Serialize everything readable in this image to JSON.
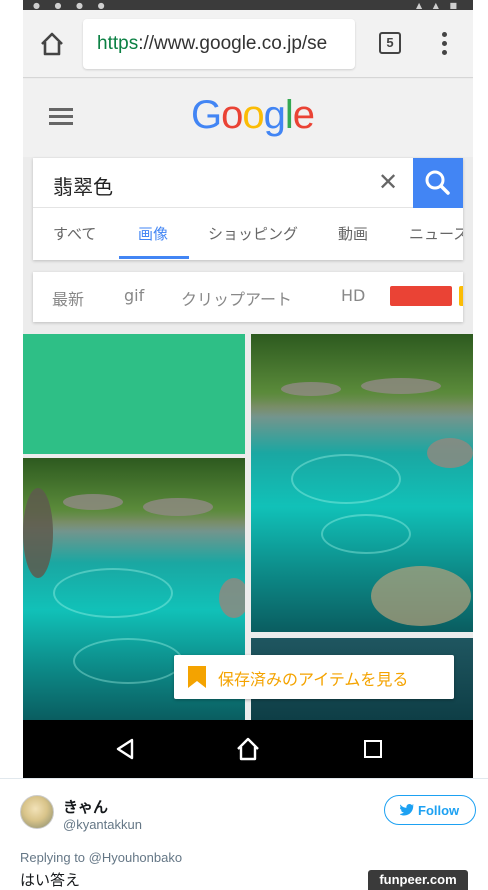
{
  "browser": {
    "url_scheme": "https",
    "url_rest": "://www.google.co.jp/se",
    "tab_count": "5"
  },
  "google": {
    "logo_letters": [
      "G",
      "o",
      "o",
      "g",
      "l",
      "e"
    ],
    "search_query": "翡翠色",
    "tabs": [
      {
        "label": "すべて",
        "active": false
      },
      {
        "label": "画像",
        "active": true
      },
      {
        "label": "ショッピング",
        "active": false
      },
      {
        "label": "動画",
        "active": false
      },
      {
        "label": "ニュース",
        "active": false
      }
    ],
    "chips": [
      "最新",
      "gif",
      "クリップアート",
      "HD"
    ],
    "chip_colors": [
      "#ea4335",
      "#fbbc05"
    ],
    "saved_items_label": "保存済みのアイテムを見る",
    "tile_color": "#2ebf86"
  },
  "navbar": {
    "icons": [
      "back-icon",
      "home-icon",
      "recent-apps-icon"
    ]
  },
  "tweet": {
    "display_name": "きゃん",
    "handle": "@kyantakkun",
    "follow_label": "Follow",
    "replying_to": "Replying to @Hyouhonbako",
    "text": "はい答え"
  },
  "watermark": "funpeer.com"
}
